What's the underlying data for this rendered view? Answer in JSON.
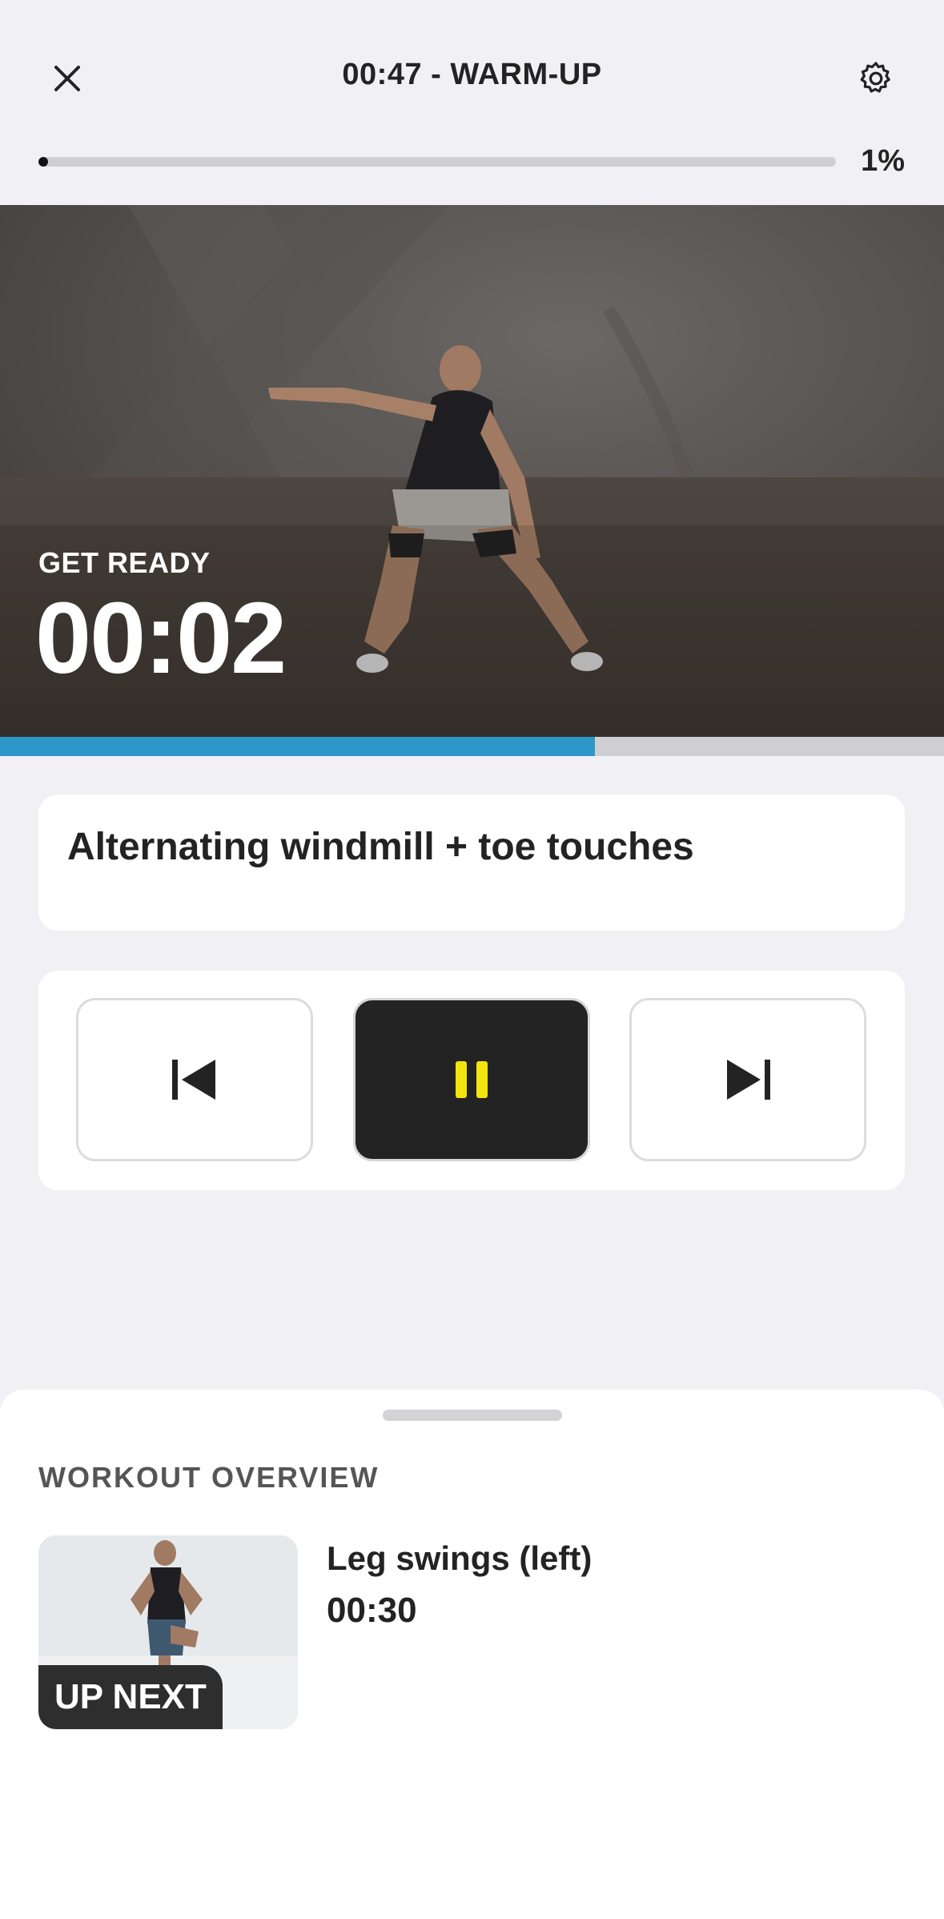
{
  "header": {
    "title": "00:47 - WARM-UP",
    "progress_percent_label": "1%",
    "progress_value": 0.01,
    "close_icon": "close-icon",
    "settings_icon": "gear-icon"
  },
  "video": {
    "status_label": "GET READY",
    "countdown": "00:02",
    "timer_progress": 0.63
  },
  "exercise": {
    "name": "Alternating windmill + toe touches"
  },
  "controls": {
    "previous_icon": "skip-previous-icon",
    "pause_icon": "pause-icon",
    "next_icon": "skip-next-icon"
  },
  "sheet": {
    "title": "WORKOUT OVERVIEW",
    "up_next": {
      "badge": "UP NEXT",
      "name": "Leg swings (left)",
      "duration": "00:30"
    }
  },
  "colors": {
    "background": "#f1f0f5",
    "accent_blue": "#2c97c8",
    "pause_yellow": "#f2e40e",
    "dark": "#232323"
  }
}
